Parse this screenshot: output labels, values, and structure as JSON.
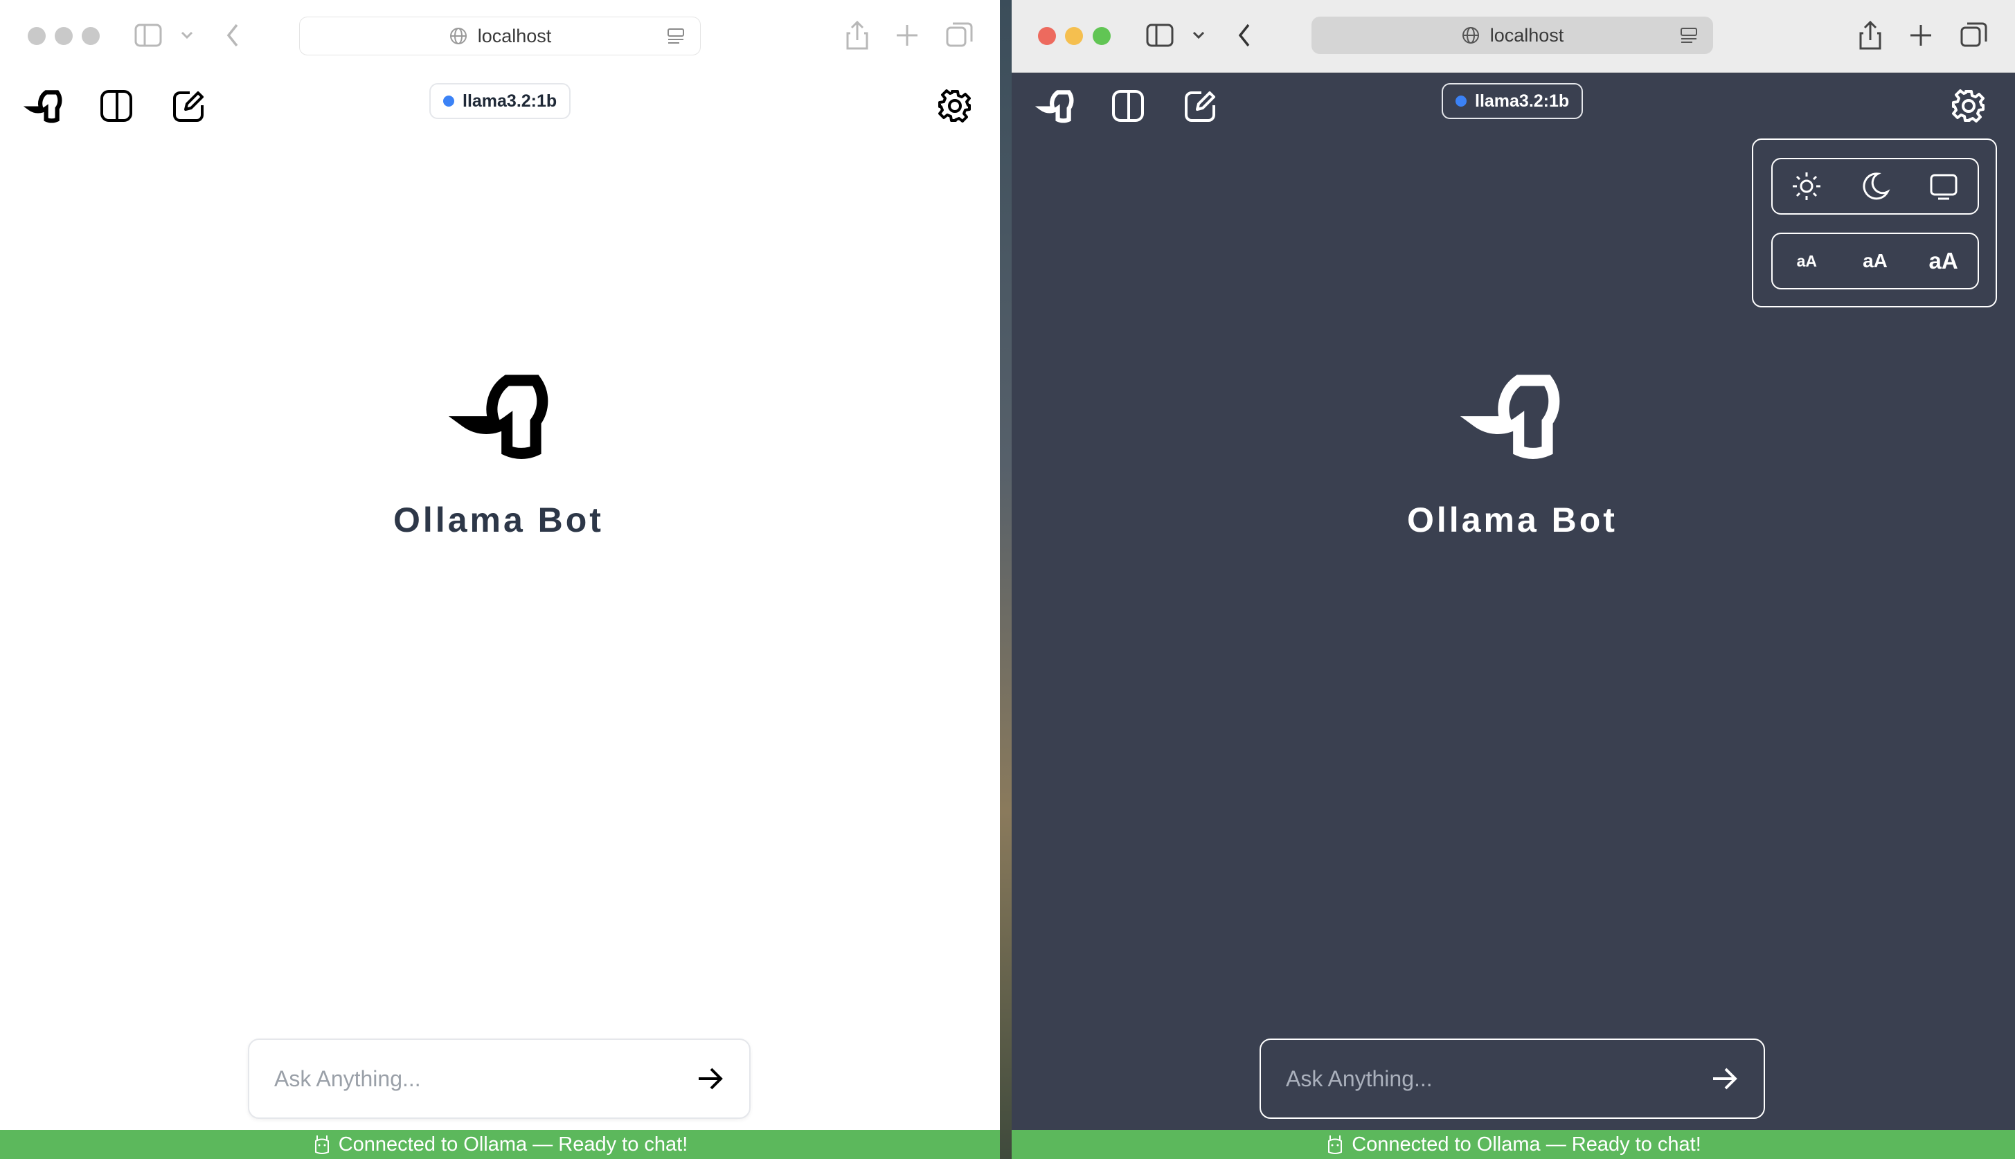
{
  "windows": {
    "light": {
      "address": "localhost",
      "model": "llama3.2:1b",
      "title": "Ollama Bot",
      "placeholder": "Ask Anything...",
      "status": "Connected to Ollama — Ready to chat!"
    },
    "dark": {
      "address": "localhost",
      "model": "llama3.2:1b",
      "title": "Ollama Bot",
      "placeholder": "Ask Anything...",
      "status": "Connected to Ollama — Ready to chat!",
      "settings": {
        "theme_options": [
          "sun-icon",
          "moon-icon",
          "monitor-icon"
        ],
        "font_sizes": {
          "small": "aA",
          "medium": "aA",
          "large": "aA"
        }
      }
    }
  },
  "colors": {
    "light_bg": "#ffffff",
    "dark_bg": "#3a4050",
    "status_green": "#5cb85c",
    "model_dot": "#3b82f6",
    "traffic_red": "#ed6a5e",
    "traffic_yellow": "#f5bf4f",
    "traffic_green": "#61c554"
  }
}
